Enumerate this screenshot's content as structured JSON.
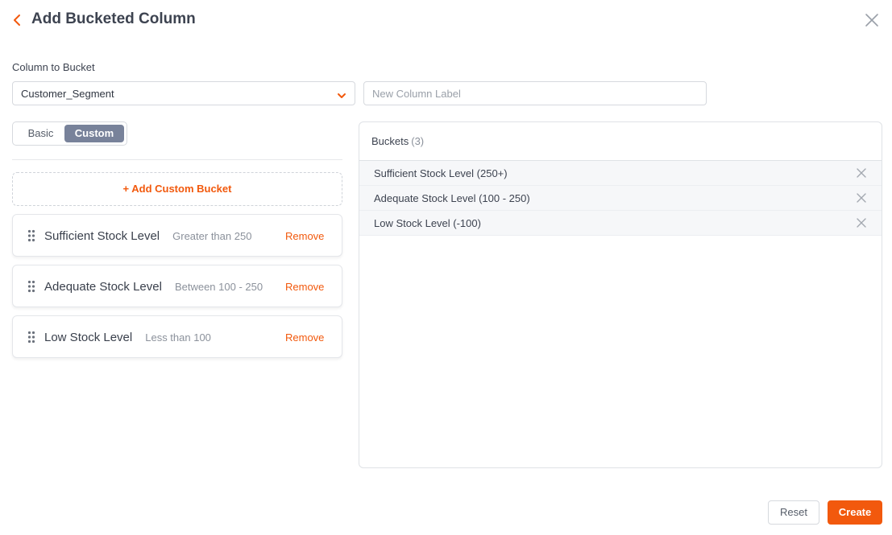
{
  "header": {
    "title": "Add Bucketed Column",
    "back_icon": "chevron-left-icon",
    "close_icon": "close-icon"
  },
  "column_to_bucket": {
    "label": "Column to Bucket",
    "selected_value": "Customer_Segment"
  },
  "new_column": {
    "placeholder": "New Column Label",
    "value": ""
  },
  "mode_toggle": {
    "basic_label": "Basic",
    "custom_label": "Custom",
    "active": "Custom"
  },
  "add_custom_bucket_label": "+ Add Custom Bucket",
  "custom_buckets": [
    {
      "name": "Sufficient Stock Level",
      "description": "Greater than 250",
      "remove_label": "Remove"
    },
    {
      "name": "Adequate Stock Level",
      "description": "Between 100 - 250",
      "remove_label": "Remove"
    },
    {
      "name": "Low Stock Level",
      "description": "Less than 100",
      "remove_label": "Remove"
    }
  ],
  "buckets_panel": {
    "title": "Buckets",
    "count": "(3)",
    "items": [
      "Sufficient Stock Level (250+)",
      "Adequate Stock Level (100 - 250)",
      "Low Stock Level (-100)"
    ]
  },
  "footer": {
    "reset_label": "Reset",
    "create_label": "Create"
  },
  "colors": {
    "accent": "#f2590d",
    "toggle_active": "#78829a"
  }
}
